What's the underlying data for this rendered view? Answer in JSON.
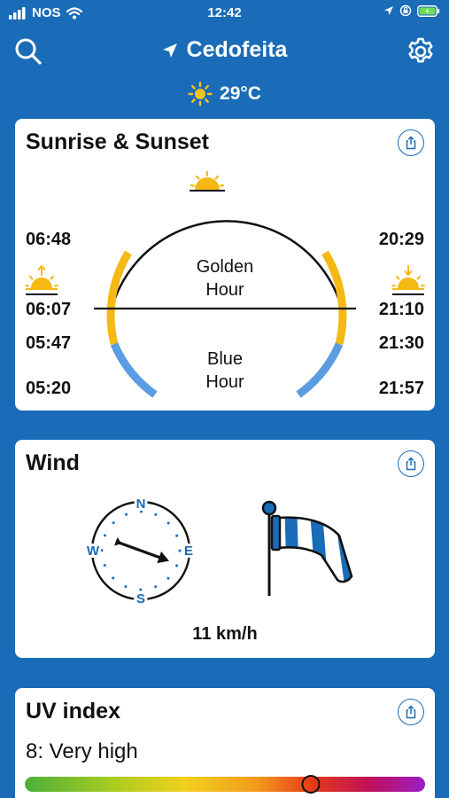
{
  "status_bar": {
    "carrier": "NOS",
    "time": "12:42"
  },
  "header": {
    "location": "Cedofeita"
  },
  "weather": {
    "temperature": "29°C",
    "condition_icon": "sun-icon"
  },
  "sunrise_sunset": {
    "title": "Sunrise & Sunset",
    "left_times": [
      "06:48",
      "06:07",
      "05:47",
      "05:20"
    ],
    "right_times": [
      "20:29",
      "21:10",
      "21:30",
      "21:57"
    ],
    "golden_hour_label": [
      "Golden",
      "Hour"
    ],
    "blue_hour_label": [
      "Blue",
      "Hour"
    ],
    "golden_color": "#f5b914",
    "blue_color": "#5b9de0"
  },
  "wind": {
    "title": "Wind",
    "speed": "11 km/h",
    "compass": {
      "n": "N",
      "e": "E",
      "s": "S",
      "w": "W"
    },
    "direction_deg": 110,
    "accent_color": "#1a6cb8"
  },
  "uv_index": {
    "title": "UV index",
    "value_label": "8: Very high",
    "level_fraction": 0.715
  }
}
